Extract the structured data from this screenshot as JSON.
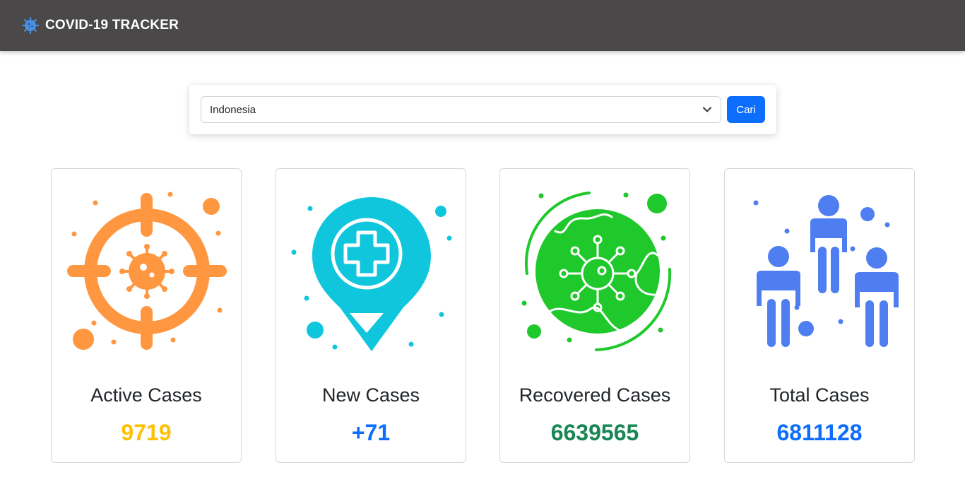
{
  "header": {
    "brand": "COVID-19 TRACKER",
    "icon": "virus-icon"
  },
  "search": {
    "selected_country": "Indonesia",
    "button_label": "Cari"
  },
  "cards": [
    {
      "title": "Active Cases",
      "value": "9719",
      "color": "#ffc107",
      "icon": "target-virus-icon",
      "icon_color": "#ff9640"
    },
    {
      "title": "New Cases",
      "value": "+71",
      "color": "#0d6efd",
      "icon": "location-pin-plus-icon",
      "icon_color": "#10c6dc"
    },
    {
      "title": "Recovered Cases",
      "value": "6639565",
      "color": "#198754",
      "icon": "globe-virus-icon",
      "icon_color": "#1fc82b"
    },
    {
      "title": "Total Cases",
      "value": "6811128",
      "color": "#0d6efd",
      "icon": "people-icon",
      "icon_color": "#4f7ef0"
    }
  ]
}
